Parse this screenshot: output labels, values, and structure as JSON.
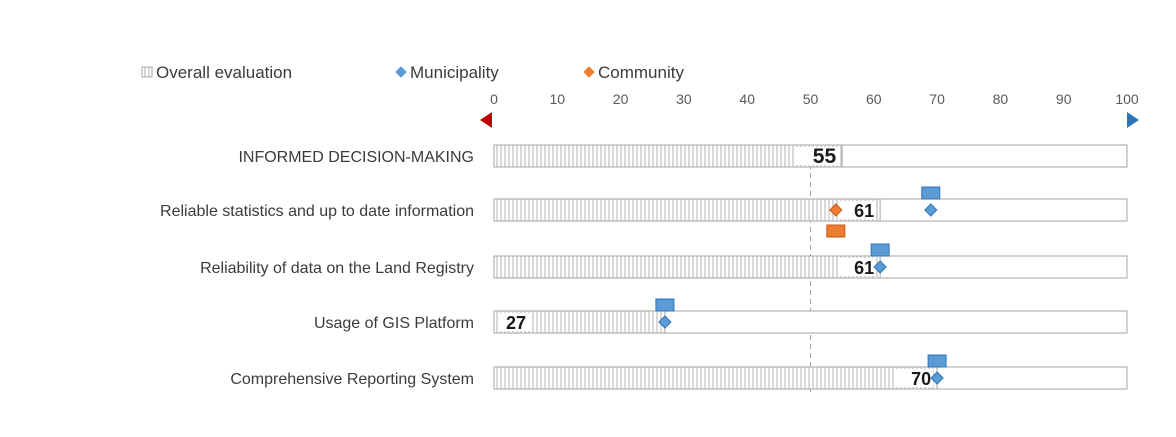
{
  "chart_data": {
    "type": "bar",
    "orientation": "horizontal",
    "xlim": [
      0,
      100
    ],
    "x_ticks": [
      "0",
      "10",
      "20",
      "30",
      "40",
      "50",
      "60",
      "70",
      "80",
      "90",
      "100"
    ],
    "reference_line": 50,
    "legend": {
      "position": "top",
      "items": [
        {
          "label": "Overall evaluation",
          "marker": "hatched-square",
          "color": "#bfbfbf"
        },
        {
          "label": "Municipality",
          "marker": "diamond",
          "color": "#5b9bd5"
        },
        {
          "label": "Community",
          "marker": "diamond",
          "color": "#ed7d31"
        }
      ]
    },
    "categories": [
      "INFORMED DECISION-MAKING",
      "Reliable statistics and up to date information",
      "Reliability of data on the Land Registry",
      "Usage of GIS Platform",
      "Comprehensive Reporting System"
    ],
    "series": [
      {
        "name": "Overall evaluation",
        "values": [
          55,
          61,
          61,
          27,
          70
        ],
        "data_labels": [
          "55",
          "61",
          "61",
          "27",
          "70"
        ]
      },
      {
        "name": "Municipality",
        "values": [
          null,
          69,
          61,
          27,
          70
        ]
      },
      {
        "name": "Community",
        "values": [
          null,
          54,
          null,
          null,
          null
        ]
      }
    ],
    "gradient_arrow": {
      "left_color": "#c00000",
      "right_color": "#2e75b6"
    },
    "colors": {
      "bar_fill": "#ffffff",
      "bar_hatch": "#b3b3b3",
      "bar_border": "#a6a6a6",
      "municipality": "#5b9bd5",
      "community": "#ed7d31"
    }
  }
}
